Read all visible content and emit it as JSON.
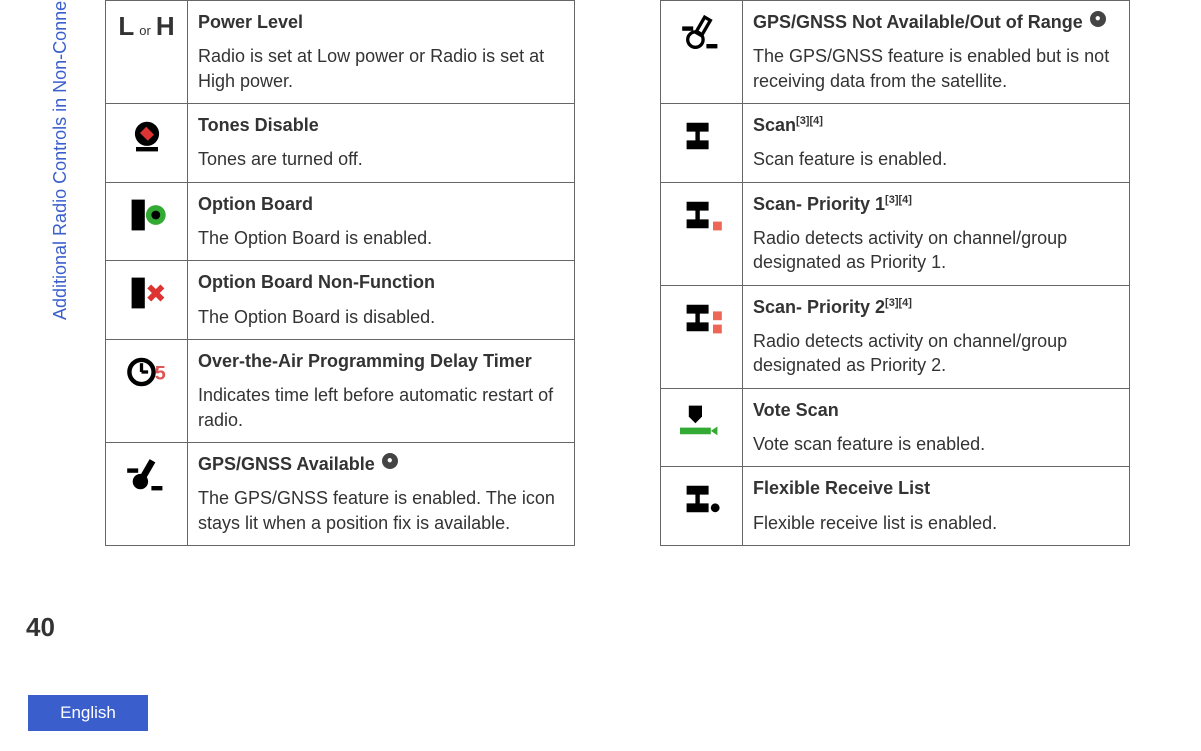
{
  "sidebar": {
    "section_title": "Additional Radio Controls in Non-Connect Plus Mode"
  },
  "page_number": "40",
  "language": "English",
  "left": [
    {
      "icon": "power-level-icon",
      "or_text": "or",
      "title": "Power Level",
      "desc": "Radio is set at Low power or Radio is set at High power."
    },
    {
      "icon": "tones-disable-icon",
      "title": "Tones Disable",
      "desc": "Tones are turned off."
    },
    {
      "icon": "option-board-icon",
      "title": "Option Board",
      "desc": "The Option Board is enabled."
    },
    {
      "icon": "option-board-nf-icon",
      "title": "Option Board Non-Function",
      "desc": "The Option Board is disabled."
    },
    {
      "icon": "otap-timer-icon",
      "title": "Over-the-Air Programming Delay Timer",
      "desc": "Indicates time left before automatic restart of radio."
    },
    {
      "icon": "gps-available-icon",
      "title": "GPS/GNSS Available",
      "title_badge": "●",
      "desc": "The GPS/GNSS feature is enabled. The icon stays lit when a position fix is available."
    }
  ],
  "right": [
    {
      "icon": "gps-not-available-icon",
      "title": "GPS/GNSS Not Available/Out of Range",
      "title_badge": "●",
      "desc": "The GPS/GNSS feature is enabled but is not receiving data from the satellite."
    },
    {
      "icon": "scan-icon",
      "title": "Scan",
      "title_sup": "[3][4]",
      "desc": "Scan feature is enabled."
    },
    {
      "icon": "scan-p1-icon",
      "title": "Scan- Priority 1",
      "title_sup": "[3][4]",
      "desc": "Radio detects activity on channel/group designated as Priority 1."
    },
    {
      "icon": "scan-p2-icon",
      "title": "Scan- Priority 2",
      "title_sup": "[3][4]",
      "desc": "Radio detects activity on channel/group designated as Priority 2."
    },
    {
      "icon": "vote-scan-icon",
      "title": "Vote Scan",
      "desc": "Vote scan feature is enabled."
    },
    {
      "icon": "flex-rx-icon",
      "title": "Flexible Receive List",
      "desc": "Flexible receive list is enabled."
    }
  ]
}
